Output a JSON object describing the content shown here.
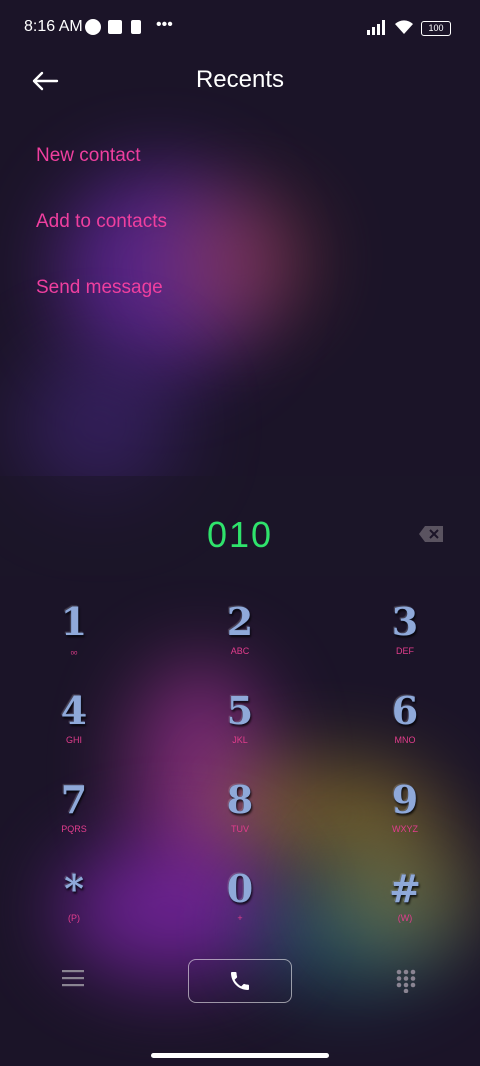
{
  "status_bar": {
    "time": "8:16 AM",
    "battery": "100"
  },
  "header": {
    "title": "Recents"
  },
  "menu": [
    {
      "label": "New contact"
    },
    {
      "label": "Add to contacts"
    },
    {
      "label": "Send message"
    }
  ],
  "dialed_number": "010",
  "keypad": [
    {
      "digit": "1",
      "letters": "ₒₒ"
    },
    {
      "digit": "2",
      "letters": "ABC"
    },
    {
      "digit": "3",
      "letters": "DEF"
    },
    {
      "digit": "4",
      "letters": "GHI"
    },
    {
      "digit": "5",
      "letters": "JKL"
    },
    {
      "digit": "6",
      "letters": "MNO"
    },
    {
      "digit": "7",
      "letters": "PQRS"
    },
    {
      "digit": "8",
      "letters": "TUV"
    },
    {
      "digit": "9",
      "letters": "WXYZ"
    },
    {
      "digit": "*",
      "letters": "(P)"
    },
    {
      "digit": "0",
      "letters": "+"
    },
    {
      "digit": "#",
      "letters": "(W)"
    }
  ],
  "colors": {
    "accent": "#ef3f9f",
    "number": "#2fe36c"
  }
}
